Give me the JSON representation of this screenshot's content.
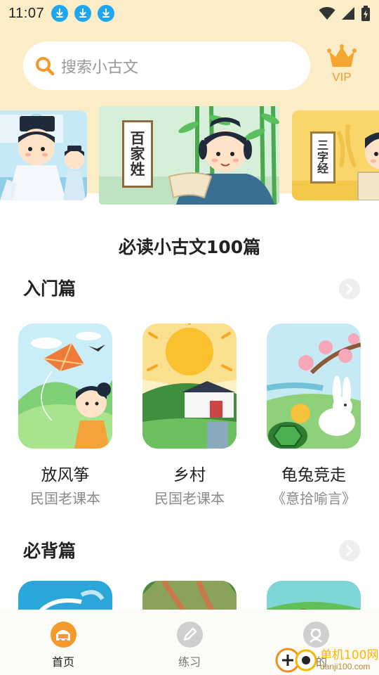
{
  "status_bar": {
    "time": "11:07",
    "download_icon_count": 3
  },
  "search": {
    "placeholder": "搜索小古文"
  },
  "vip": {
    "label": "VIP",
    "color": "#f39a2a"
  },
  "banners": [
    {
      "id": "left",
      "plaque": ""
    },
    {
      "id": "center",
      "plaque": [
        "百",
        "家",
        "姓"
      ]
    },
    {
      "id": "right",
      "plaque": [
        "三",
        "字",
        "经"
      ]
    }
  ],
  "main_title": "必读小古文100篇",
  "sections": [
    {
      "title": "入门篇",
      "items": [
        {
          "title": "放风筝",
          "subtitle": "民国老课本"
        },
        {
          "title": "乡村",
          "subtitle": "民国老课本"
        },
        {
          "title": "龟兔竞走",
          "subtitle": "《意拾喻言》"
        }
      ]
    },
    {
      "title": "必背篇"
    }
  ],
  "bottom_nav": [
    {
      "label": "首页",
      "icon": "home-icon",
      "active": true
    },
    {
      "label": "练习",
      "icon": "pencil-icon",
      "active": false
    },
    {
      "label": "我的",
      "icon": "profile-icon",
      "active": false
    }
  ],
  "watermark": {
    "text": "单机100网",
    "url": "danji100.com"
  },
  "colors": {
    "accent": "#f39a2a",
    "header_bg": "#fbedc8",
    "download_blue": "#1ea7f0"
  }
}
